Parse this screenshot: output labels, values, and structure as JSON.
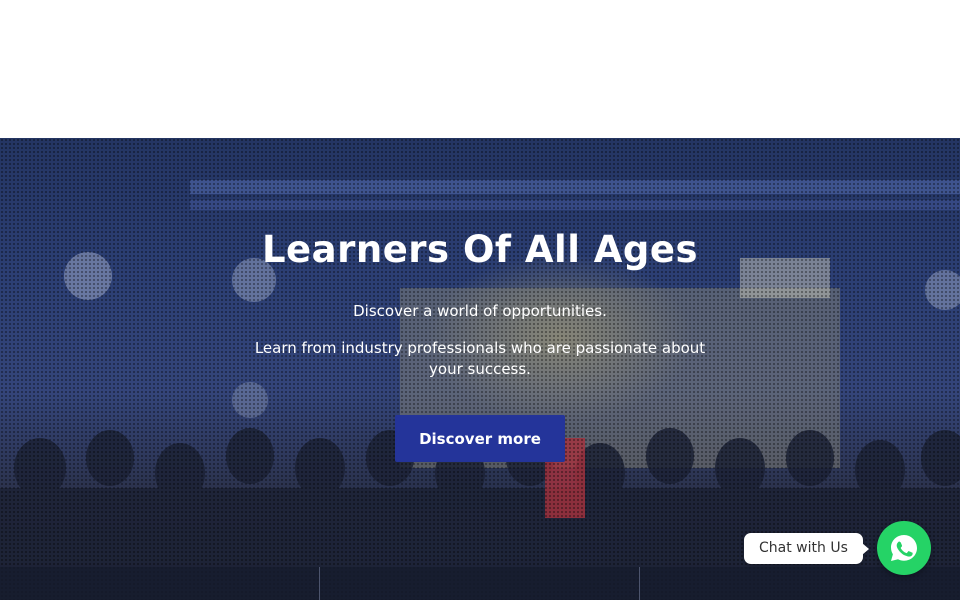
{
  "hero": {
    "title": "Learners Of All Ages",
    "subtitle": "Discover a world of opportunities.",
    "description": "Learn from industry professionals who are passionate about your success.",
    "cta_label": "Discover more",
    "cta_color": "#24349a"
  },
  "chat": {
    "label": "Chat with Us",
    "icon": "whatsapp-icon",
    "color": "#25d366"
  }
}
